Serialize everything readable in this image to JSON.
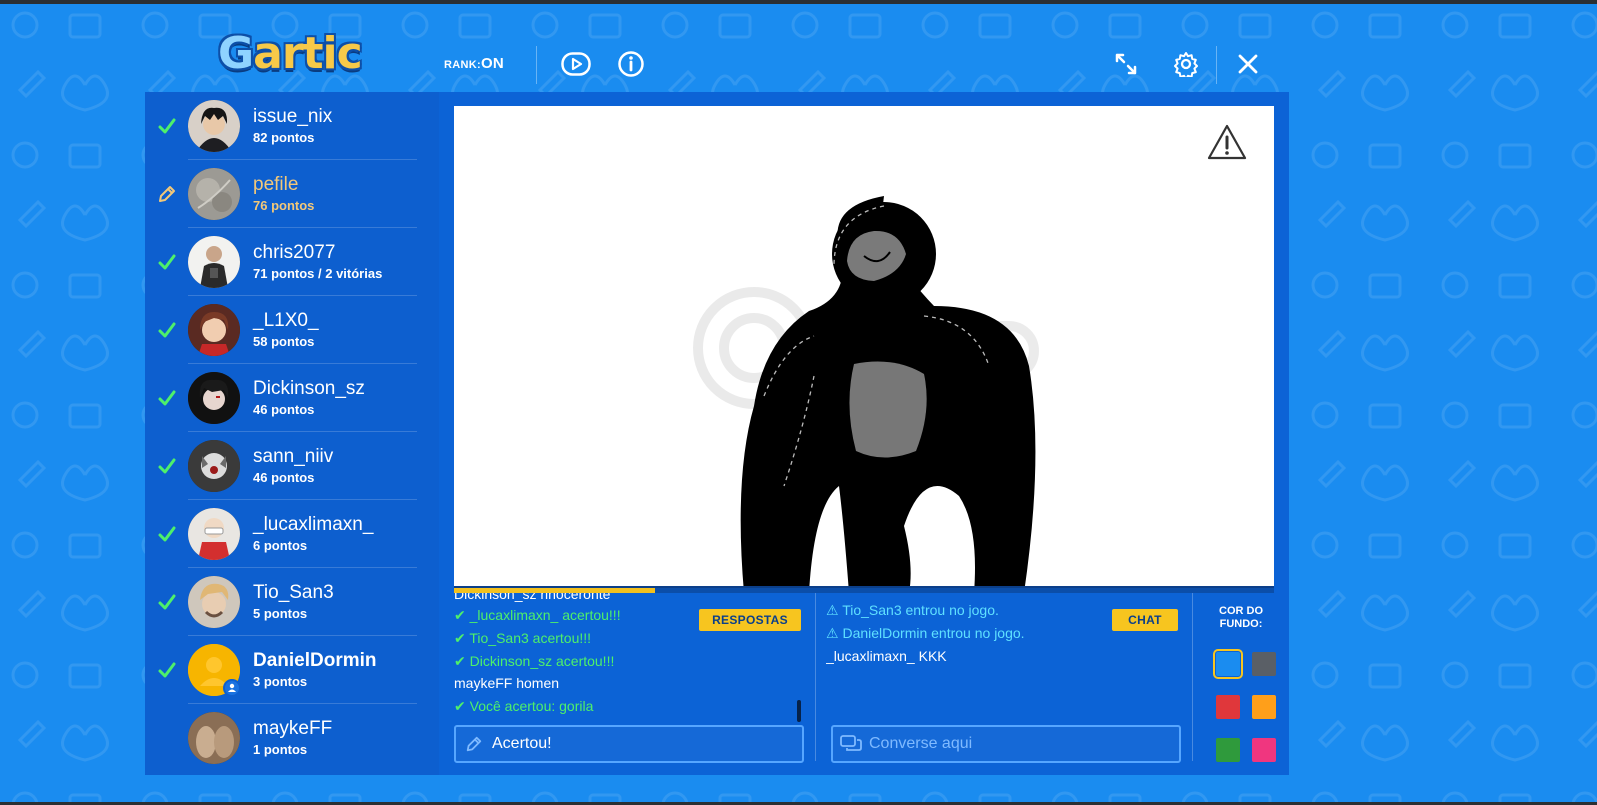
{
  "header": {
    "logo": "Gartic",
    "rank_label": "RANK:",
    "rank_value": "ON"
  },
  "players": [
    {
      "name": "issue_nix",
      "score": "82 pontos",
      "status": "check-icon"
    },
    {
      "name": "pefile",
      "score": "76 pontos",
      "status": "pencil-icon",
      "drawer": true
    },
    {
      "name": "chris2077",
      "score": "71 pontos / 2 vitórias",
      "status": "check-icon"
    },
    {
      "name": "_L1X0_",
      "score": "58 pontos",
      "status": "check-icon"
    },
    {
      "name": "Dickinson_sz",
      "score": "46 pontos",
      "status": "check-icon"
    },
    {
      "name": "sann_niiv",
      "score": "46 pontos",
      "status": "check-icon"
    },
    {
      "name": "_lucaxlimaxn_",
      "score": "6 pontos",
      "status": "check-icon"
    },
    {
      "name": "Tio_San3",
      "score": "5 pontos",
      "status": "check-icon"
    },
    {
      "name": "DanielDormin",
      "score": "3 pontos",
      "status": "check-icon",
      "me": true
    },
    {
      "name": "maykeFF",
      "score": "1 pontos",
      "status": "none"
    }
  ],
  "colors": {
    "background": "#1a8cf0",
    "panel": "#0c63d6",
    "accent_yellow": "#f7c51f",
    "correct_green": "#4ef06a",
    "system_cyan": "#5fe0ff"
  },
  "timer_progress": 0.245,
  "answers": {
    "button": "RESPOSTAS",
    "messages": [
      {
        "text": "Dickinson_sz rinoceronte",
        "type": "plain"
      },
      {
        "text": "_lucaxlimaxn_ acertou!!!",
        "type": "correct"
      },
      {
        "text": "Tio_San3 acertou!!!",
        "type": "correct"
      },
      {
        "text": "Dickinson_sz acertou!!!",
        "type": "correct"
      },
      {
        "user": "maykeFF",
        "text": "homen",
        "type": "plain"
      },
      {
        "text": "Você acertou: gorila",
        "type": "correct"
      }
    ],
    "input_value": "Acertou!"
  },
  "chat": {
    "button": "CHAT",
    "messages": [
      {
        "text": "Tio_San3 entrou no jogo.",
        "type": "system"
      },
      {
        "text": "DanielDormin entrou no jogo.",
        "type": "system"
      },
      {
        "user": "_lucaxlimaxn_",
        "text": "KKK",
        "type": "plain"
      }
    ],
    "placeholder": "Converse aqui"
  },
  "background_color": {
    "label_line1": "COR DO",
    "label_line2": "FUNDO:",
    "swatches": [
      "#1a8cf0",
      "#5a5f66",
      "#e0373b",
      "#ff9f1a",
      "#2f9a3c",
      "#f0367f"
    ],
    "selected": 0
  }
}
